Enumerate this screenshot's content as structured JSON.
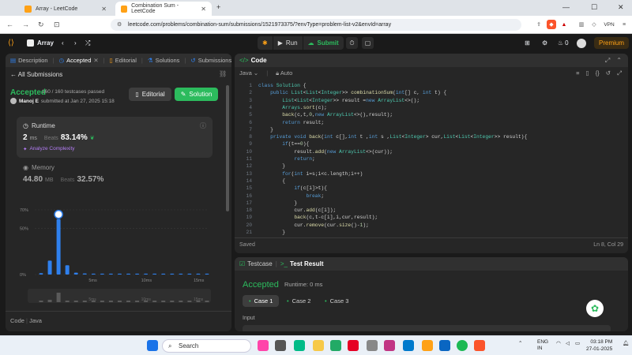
{
  "browser": {
    "tabs": [
      {
        "title": "Array - LeetCode",
        "active": false
      },
      {
        "title": "Combination Sum - LeetCode",
        "active": true
      }
    ],
    "url": "leetcode.com/problems/combination-sum/submissions/1521973375/?envType=problem-list-v2&envId=array",
    "vpn_label": "VPN"
  },
  "lc_header": {
    "problem_list": "Array",
    "run_label": "Run",
    "submit_label": "Submit",
    "streak": "0",
    "premium_label": "Premium"
  },
  "left_panel": {
    "tabs": [
      "Description",
      "Accepted",
      "Editorial",
      "Solutions",
      "Submissions"
    ],
    "all_submissions": "All Submissions",
    "status": "Accepted",
    "testcases": "160 / 160 testcases passed",
    "author": "Manoj E",
    "submitted_at": "submitted at Jan 27, 2025 15:18",
    "editorial_btn": "Editorial",
    "solution_btn": "Solution",
    "runtime": {
      "label": "Runtime",
      "value": "2",
      "unit": "ms",
      "beats_label": "Beats",
      "beats_value": "83.14%",
      "analyze": "Analyze Complexity"
    },
    "memory": {
      "label": "Memory",
      "value": "44.80",
      "unit": "MB",
      "beats_label": "Beats",
      "beats_value": "32.57%"
    },
    "code_label": "Code",
    "lang_label": "Java"
  },
  "chart_data": {
    "type": "bar",
    "title": "",
    "xlabel": "",
    "ylabel": "",
    "y_ticks": [
      "70%",
      "50%",
      "0%"
    ],
    "ylim": [
      0,
      70
    ],
    "x_tick_labels": [
      "5ms",
      "10ms",
      "15ms"
    ],
    "categories": [
      "0",
      "1",
      "2",
      "3",
      "4",
      "5",
      "6",
      "7",
      "8",
      "9",
      "10",
      "11",
      "12",
      "13",
      "14",
      "15",
      "16",
      "17",
      "18",
      "19"
    ],
    "values": [
      1.5,
      15,
      60,
      10,
      2,
      1.2,
      1,
      1,
      1,
      1,
      1,
      1,
      1,
      1,
      1,
      1,
      1,
      1,
      1,
      1
    ],
    "highlight_index": 2
  },
  "code_panel": {
    "title": "Code",
    "language": "Java",
    "mode": "Auto",
    "saved": "Saved",
    "cursor": "Ln 8, Col 29",
    "lines": [
      "class Solution {",
      "    public List<List<Integer>> combinationSum(int[] c, int t) {",
      "        List<List<Integer>> result =new ArrayList<>();",
      "        Arrays.sort(c);",
      "        back(c,t,0,new ArrayList<>(),result);",
      "        return result;",
      "    }",
      "    private void back(int c[],int t ,int s ,List<Integer> cur,List<List<Integer>> result){",
      "        if(t==0){",
      "            result.add(new ArrayList<>(cur));",
      "            return;",
      "        }",
      "        for(int i=s;i<c.length;i++)",
      "        {",
      "            if(c[i]>t){",
      "                break;",
      "            }",
      "            cur.add(c[i]);",
      "            back(c,t-c[i],i,cur,result);",
      "            cur.remove(cur.size()-1);",
      "        }"
    ]
  },
  "result_panel": {
    "testcase_tab": "Testcase",
    "result_tab": "Test Result",
    "status": "Accepted",
    "runtime": "Runtime: 0 ms",
    "cases": [
      "Case 1",
      "Case 2",
      "Case 3"
    ],
    "input_label": "Input"
  },
  "taskbar": {
    "search_placeholder": "Search",
    "lang": "ENG",
    "region": "IN",
    "time": "03:18 PM",
    "date": "27-01-2025"
  },
  "colors": {
    "accent_green": "#2cbb5d",
    "accent_orange": "#ffa116",
    "bar_blue": "#2f80ed"
  }
}
